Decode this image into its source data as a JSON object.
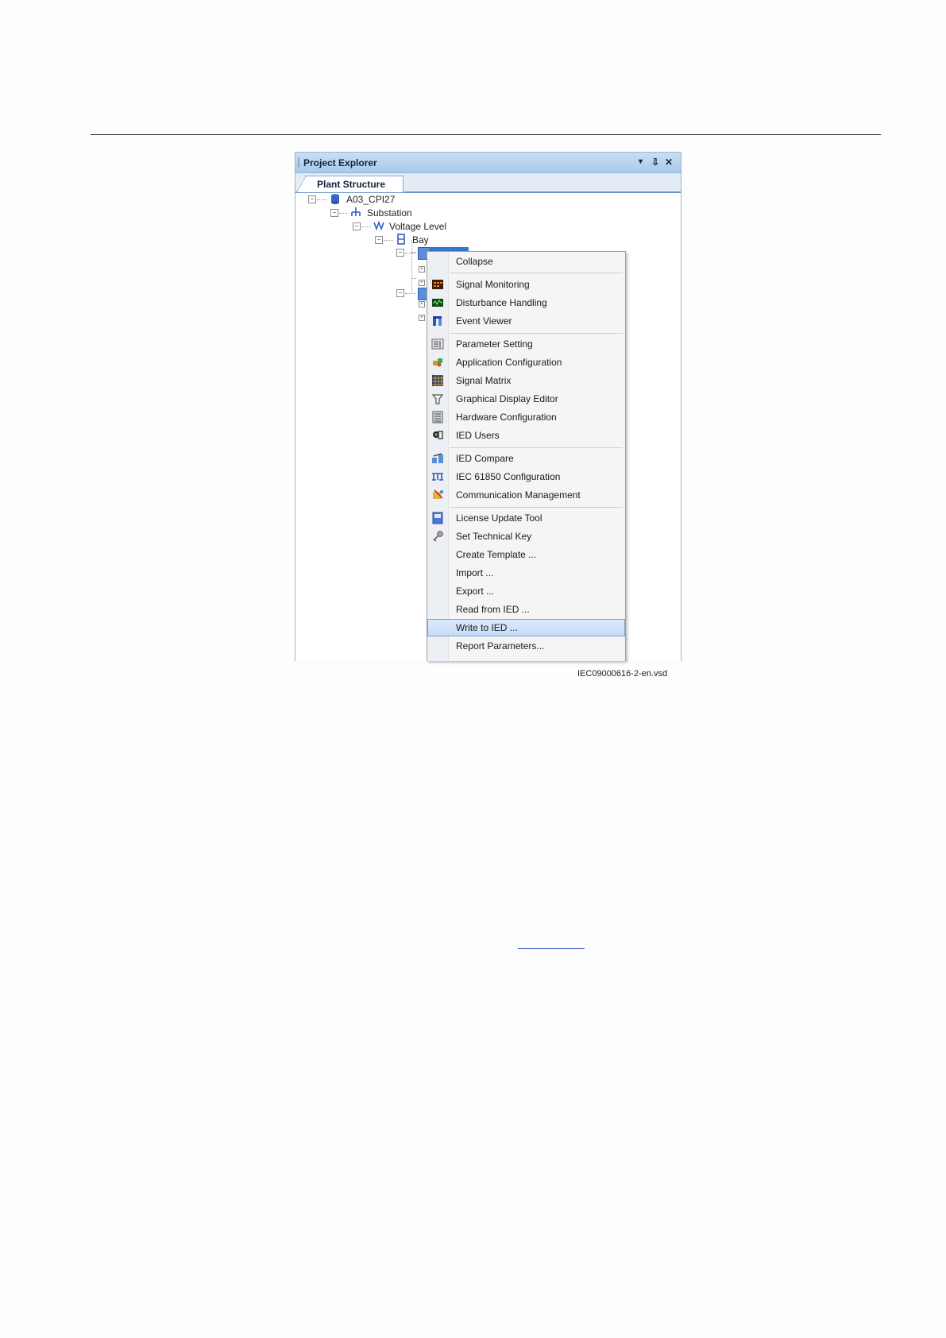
{
  "panel": {
    "title": "Project Explorer",
    "buttons": {
      "dropdown": "▾",
      "pin": "⇩",
      "close": "✕"
    },
    "tab": "Plant Structure"
  },
  "tree": {
    "nodes": [
      {
        "label": "A03_CPI27",
        "icon": "database-icon"
      },
      {
        "label": "Substation",
        "icon": "substation-icon"
      },
      {
        "label": "Voltage Level",
        "icon": "voltage-level-icon"
      },
      {
        "label": "Bay",
        "icon": "bay-icon"
      }
    ]
  },
  "menu": {
    "items": [
      {
        "label": "Collapse",
        "icon": ""
      },
      {
        "label": "Signal Monitoring",
        "icon": "signal-monitoring-icon"
      },
      {
        "label": "Disturbance Handling",
        "icon": "disturbance-handling-icon"
      },
      {
        "label": "Event Viewer",
        "icon": "event-viewer-icon"
      },
      {
        "label": "Parameter Setting",
        "icon": "parameter-setting-icon"
      },
      {
        "label": "Application Configuration",
        "icon": "application-configuration-icon"
      },
      {
        "label": "Signal Matrix",
        "icon": "signal-matrix-icon"
      },
      {
        "label": "Graphical Display Editor",
        "icon": "graphical-display-editor-icon"
      },
      {
        "label": "Hardware Configuration",
        "icon": "hardware-configuration-icon"
      },
      {
        "label": "IED Users",
        "icon": "ied-users-icon"
      },
      {
        "label": "IED Compare",
        "icon": "ied-compare-icon"
      },
      {
        "label": "IEC 61850 Configuration",
        "icon": "iec61850-configuration-icon"
      },
      {
        "label": "Communication Management",
        "icon": "communication-management-icon"
      },
      {
        "label": "License Update Tool",
        "icon": "license-update-tool-icon"
      },
      {
        "label": "Set Technical Key",
        "icon": "technical-key-icon"
      },
      {
        "label": "Create Template ...",
        "icon": ""
      },
      {
        "label": "Import ...",
        "icon": ""
      },
      {
        "label": "Export ...",
        "icon": ""
      },
      {
        "label": "Read from IED ...",
        "icon": ""
      },
      {
        "label": "Write to IED ...",
        "icon": "",
        "highlighted": true
      },
      {
        "label": "Report Parameters...",
        "icon": ""
      }
    ]
  },
  "caption": "IEC09000616-2-en.vsd"
}
